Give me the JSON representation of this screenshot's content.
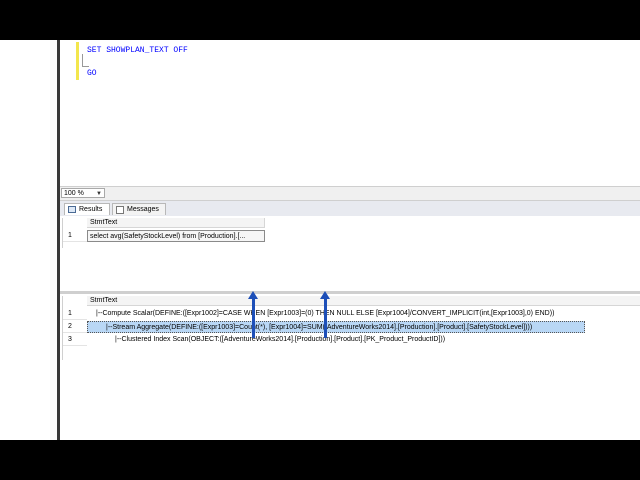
{
  "editor": {
    "lines": [
      {
        "text": "SET SHOWPLAN_TEXT OFF"
      },
      {
        "text": "GO"
      }
    ]
  },
  "statusbar": {
    "zoom_value": "100 %"
  },
  "tabs": [
    {
      "label": "Results"
    },
    {
      "label": "Messages"
    }
  ],
  "result_grids": [
    {
      "column_header": "StmtText",
      "rows": [
        {
          "num": "1",
          "text": "select avg(SafetyStockLevel) from [Production].[..."
        }
      ]
    },
    {
      "column_header": "StmtText",
      "rows": [
        {
          "num": "1",
          "text": "|--Compute Scalar(DEFINE:([Expr1002]=CASE WHEN [Expr1003]=(0) THEN NULL ELSE [Expr1004]/CONVERT_IMPLICIT(int,[Expr1003],0) END))"
        },
        {
          "num": "2",
          "text": "|--Stream Aggregate(DEFINE:([Expr1003]=Count(*), [Expr1004]=SUM([AdventureWorks2014].[Production].[Product].[SafetyStockLevel])))"
        },
        {
          "num": "3",
          "text": "|--Clustered Index Scan(OBJECT:([AdventureWorks2014].[Production].[Product].[PK_Product_ProductID]))"
        }
      ]
    }
  ],
  "annotations": {
    "arrow_color": "#1d4fb8"
  },
  "colors": {
    "keyword_blue": "#0000ff",
    "selection": "#b9d7f5",
    "change_bar": "#f3e64d"
  }
}
